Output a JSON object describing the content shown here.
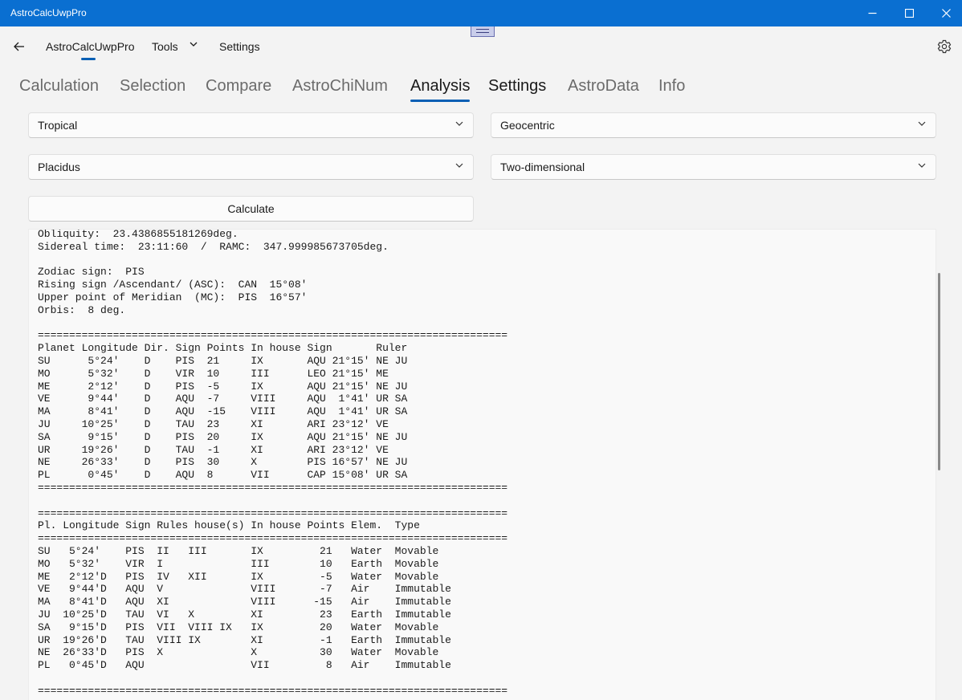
{
  "window": {
    "title": "AstroCalcUwpPro",
    "minimize_icon": "minimize-icon",
    "maximize_icon": "maximize-icon",
    "close_icon": "close-icon",
    "accent": "#0a6fd1"
  },
  "navbar": {
    "back_icon": "arrow-left-icon",
    "items": [
      {
        "label": "AstroCalcUwpPro",
        "selected": true
      },
      {
        "label": "Tools",
        "has_dropdown": true
      },
      {
        "label": "Settings"
      }
    ],
    "settings_icon": "gear-icon"
  },
  "tabs": [
    {
      "label": "Calculation"
    },
    {
      "label": "Selection"
    },
    {
      "label": "Compare"
    },
    {
      "label": "AstroChiNum"
    },
    {
      "label": "Analysis",
      "active": true
    },
    {
      "label": "Settings"
    },
    {
      "label": "AstroData"
    },
    {
      "label": "Info"
    }
  ],
  "options": {
    "zodiac": "Tropical",
    "center": "Geocentric",
    "house_system": "Placidus",
    "dimension": "Two-dimensional"
  },
  "calculate_label": "Calculate",
  "output_lines": [
    "Obliquity:  23.4386855181269deg.",
    "Sidereal time:  23:11:60  /  RAMC:  347.999985673705deg.",
    "",
    "Zodiac sign:  PIS",
    "Rising sign /Ascendant/ (ASC):  CAN  15°08'",
    "Upper point of Meridian  (MC):  PIS  16°57'",
    "Orbis:  8 deg.",
    "",
    "===========================================================================",
    "Planet Longitude Dir. Sign Points In house Sign       Ruler",
    "SU      5°24'    D    PIS  21     IX       AQU 21°15' NE JU",
    "MO      5°32'    D    VIR  10     III      LEO 21°15' ME",
    "ME      2°12'    D    PIS  -5     IX       AQU 21°15' NE JU",
    "VE      9°44'    D    AQU  -7     VIII     AQU  1°41' UR SA",
    "MA      8°41'    D    AQU  -15    VIII     AQU  1°41' UR SA",
    "JU     10°25'    D    TAU  23     XI       ARI 23°12' VE",
    "SA      9°15'    D    PIS  20     IX       AQU 21°15' NE JU",
    "UR     19°26'    D    TAU  -1     XI       ARI 23°12' VE",
    "NE     26°33'    D    PIS  30     X        PIS 16°57' NE JU",
    "PL      0°45'    D    AQU  8      VII      CAP 15°08' UR SA",
    "===========================================================================",
    "",
    "===========================================================================",
    "Pl. Longitude Sign Rules house(s) In house Points Elem.  Type",
    "===========================================================================",
    "SU   5°24'    PIS  II   III       IX         21   Water  Movable",
    "MO   5°32'    VIR  I              III        10   Earth  Movable",
    "ME   2°12'D   PIS  IV   XII       IX         -5   Water  Movable",
    "VE   9°44'D   AQU  V              VIII       -7   Air    Immutable",
    "MA   8°41'D   AQU  XI             VIII      -15   Air    Immutable",
    "JU  10°25'D   TAU  VI   X         XI         23   Earth  Immutable",
    "SA   9°15'D   PIS  VII  VIII IX   IX         20   Water  Movable",
    "UR  19°26'D   TAU  VIII IX        XI         -1   Earth  Immutable",
    "NE  26°33'D   PIS  X              X          30   Water  Movable",
    "PL   0°45'D   AQU                 VII         8   Air    Immutable",
    "",
    "==========================================================================="
  ]
}
